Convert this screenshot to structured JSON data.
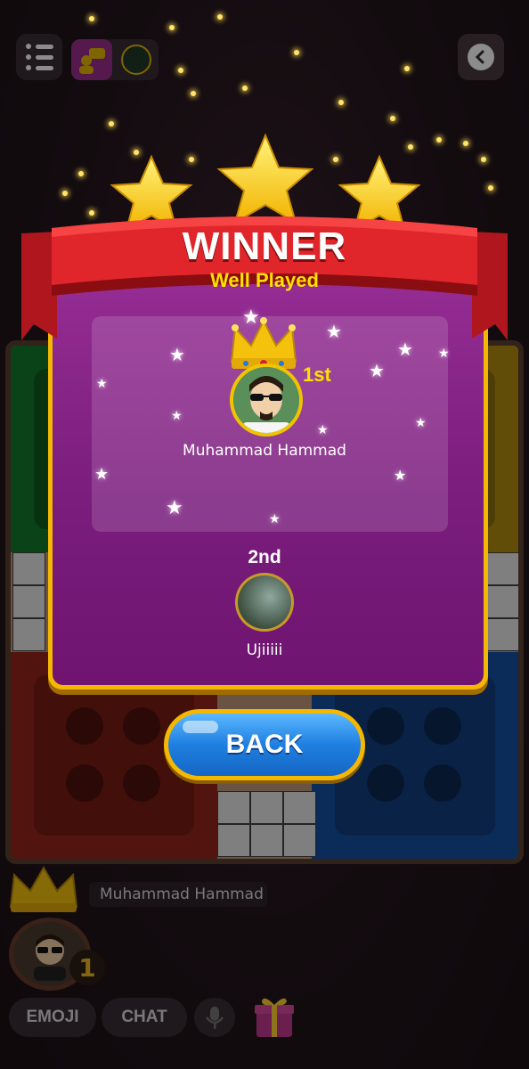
{
  "top_bar": {
    "menu_icon": "menu-list-icon",
    "players_icon": "players-icon",
    "back_icon": "chevron-left-icon"
  },
  "result_modal": {
    "title": "WINNER",
    "subtitle": "Well Played",
    "first": {
      "rank": "1st",
      "name": "Muhammad Hammad"
    },
    "second": {
      "rank": "2nd",
      "name": "Ujiiiii"
    },
    "back_label": "BACK"
  },
  "bottom_bar": {
    "player_name": "Muhammad Hammad",
    "player_rank": "1",
    "emoji_label": "EMOJI",
    "chat_label": "CHAT",
    "mic_icon": "microphone-icon",
    "gift_icon": "gift-icon"
  },
  "colors": {
    "ribbon": "#d8262a",
    "modal_gold": "#f5b800",
    "modal_purple": "#8a2489",
    "back_button": "#1f7fe0"
  }
}
